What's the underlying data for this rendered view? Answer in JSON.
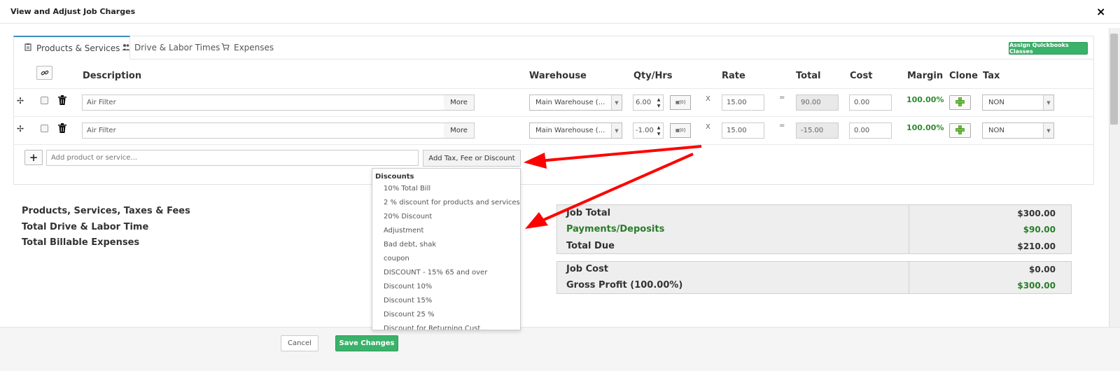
{
  "modal": {
    "title": "View and Adjust Job Charges",
    "close": "×"
  },
  "tabs": [
    {
      "label": "Products & Services",
      "active": true,
      "icon": "clipboard-icon"
    },
    {
      "label": "Drive & Labor Times",
      "active": false,
      "icon": "people-icon"
    },
    {
      "label": "Expenses",
      "active": false,
      "icon": "cart-icon"
    }
  ],
  "qb_button": "Assign Quickbooks Classes",
  "columns": {
    "description": "Description",
    "warehouse": "Warehouse",
    "qty": "Qty/Hrs",
    "rate": "Rate",
    "total": "Total",
    "cost": "Cost",
    "margin": "Margin",
    "clone": "Clone",
    "tax": "Tax"
  },
  "rows": [
    {
      "description": "Air Filter",
      "more": "More",
      "warehouse": "Main Warehouse (...",
      "qty": "6.00",
      "calc": "[0]",
      "x": "X",
      "rate": "15.00",
      "eq": "=",
      "total": "90.00",
      "cost": "0.00",
      "margin": "100.00%",
      "tax": "NON"
    },
    {
      "description": "Air Filter",
      "more": "More",
      "warehouse": "Main Warehouse (...",
      "qty": "-1.00",
      "calc": "[0]",
      "x": "X",
      "rate": "15.00",
      "eq": "=",
      "total": "-15.00",
      "cost": "0.00",
      "margin": "100.00%",
      "tax": "NON"
    }
  ],
  "add_product": {
    "plus": "+",
    "placeholder": "Add product or service...",
    "tax_button": "Add Tax, Fee or Discount"
  },
  "dropdown": {
    "header": "Discounts",
    "items": [
      "10% Total Bill",
      "2 % discount for products and services",
      "20% Discount",
      "Adjustment",
      "Bad debt, shak",
      "coupon",
      "DISCOUNT - 15% 65 and over",
      "Discount 10%",
      "Discount 15%",
      "Discount 25 %",
      "Discount for Returning Cust..."
    ]
  },
  "summary": {
    "line1": "Products, Services, Taxes & Fees",
    "line2": "Total Drive & Labor Time",
    "line3": "Total Billable Expenses"
  },
  "totals": {
    "job_total_label": "Job Total",
    "job_total": "$300.00",
    "payments_label": "Payments/Deposits",
    "payments": "$90.00",
    "total_due_label": "Total Due",
    "total_due": "$210.00",
    "job_cost_label": "Job Cost",
    "job_cost": "$0.00",
    "gross_profit_label": "Gross Profit (100.00%)",
    "gross_profit": "$300.00"
  },
  "footer": {
    "cancel": "Cancel",
    "save": "Save Changes"
  },
  "colors": {
    "accent_green": "#3ab26a",
    "margin_green": "#2e8b2e",
    "arrow_red": "#ff0000",
    "tab_blue": "#3c8dbc"
  }
}
